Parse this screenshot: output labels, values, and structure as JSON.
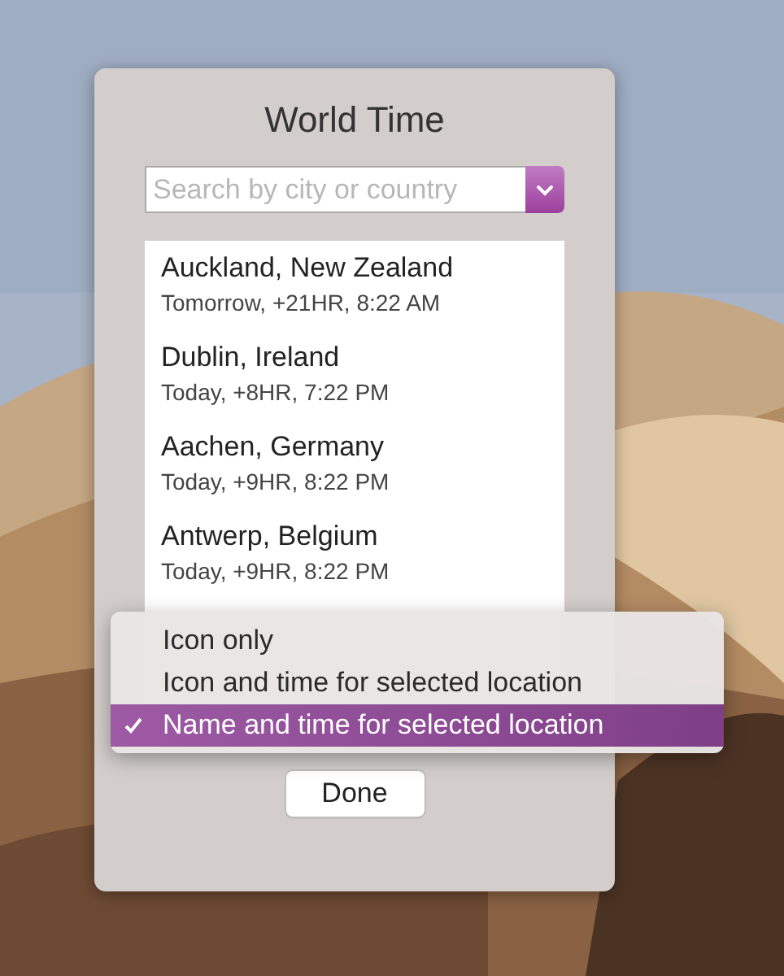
{
  "window": {
    "title": "World Time"
  },
  "search": {
    "placeholder": "Search by city or country"
  },
  "locations": [
    {
      "name": "Auckland, New Zealand",
      "detail": "Tomorrow, +21HR, 8:22 AM"
    },
    {
      "name": "Dublin, Ireland",
      "detail": "Today, +8HR, 7:22 PM"
    },
    {
      "name": "Aachen, Germany",
      "detail": "Today, +9HR, 8:22 PM"
    },
    {
      "name": "Antwerp, Belgium",
      "detail": "Today, +9HR, 8:22 PM"
    }
  ],
  "display_menu": [
    {
      "label": "Icon only",
      "selected": false
    },
    {
      "label": "Icon and time for selected location",
      "selected": false
    },
    {
      "label": "Name and time for selected location",
      "selected": true
    }
  ],
  "buttons": [
    "Done"
  ]
}
